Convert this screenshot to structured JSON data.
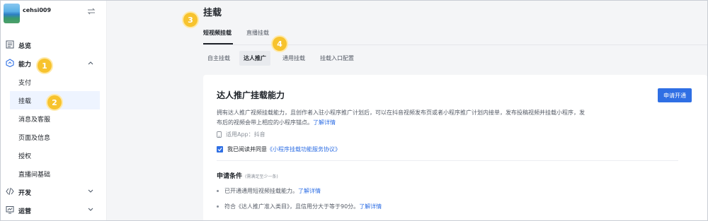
{
  "sidebar": {
    "app_name": "cehsi009",
    "items": [
      {
        "label": "总览",
        "icon": "dashboard-icon"
      },
      {
        "label": "能力",
        "icon": "ability-icon",
        "expanded": true
      },
      {
        "label": "开发",
        "icon": "code-icon"
      },
      {
        "label": "运营",
        "icon": "operations-icon"
      }
    ],
    "subitems": [
      "支付",
      "挂载",
      "消息及客服",
      "页面及信息",
      "授权",
      "直播间基础"
    ],
    "active_subitem": "挂载"
  },
  "badges": [
    "1",
    "2",
    "3",
    "4"
  ],
  "page": {
    "title": "挂载",
    "tabs": [
      "短视频挂载",
      "直播挂载"
    ],
    "active_tab": "短视频挂载",
    "subtabs": [
      "自主挂载",
      "达人推广",
      "通用挂载",
      "挂载入口配置"
    ],
    "active_subtab": "达人推广"
  },
  "card": {
    "title": "达人推广挂载能力",
    "apply_button": "申请开通",
    "desc_line1": "拥有达人推广视频挂载能力，且创作者入驻小程序推广计划后，可以在抖音视频发布页或者小程序推广计划内接单，发布投稿视频并挂载小程序，发",
    "desc_line2": "布后的视频会带上相应的小程序锚点。",
    "desc_link": "了解详情",
    "app_label": "适用App：抖音",
    "agree_text": "我已阅读并同意",
    "agree_link": "《小程序挂载功能服务协议》",
    "conditions_title": "申请条件",
    "conditions_note": "(需满足至少一条)",
    "conditions": [
      {
        "text": "已开通通用短视频挂载能力。",
        "link": "了解详情"
      },
      {
        "text": "符合《达人推广准入类目》，且信用分大于等于90分。",
        "link": "了解详情"
      }
    ]
  },
  "colors": {
    "accent": "#2f6fe4",
    "badge": "#f7c32e"
  }
}
